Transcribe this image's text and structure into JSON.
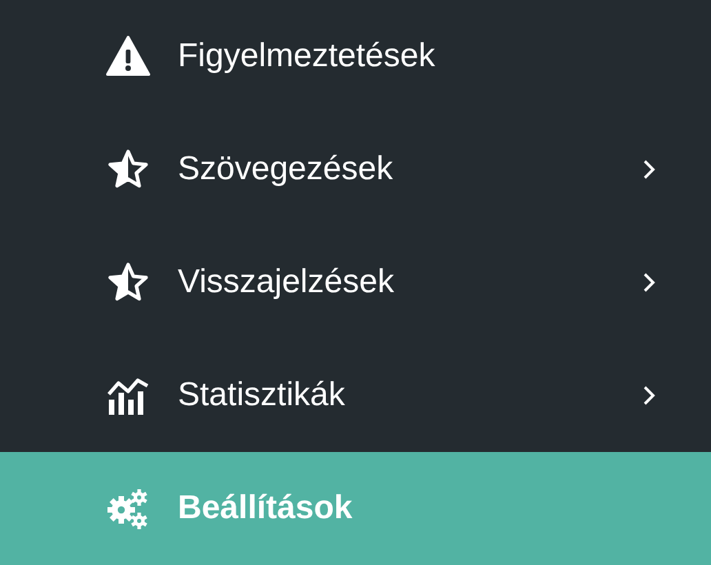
{
  "menu": {
    "items": [
      {
        "label": "Figyelmeztetések",
        "kind": "warning",
        "has_submenu": false,
        "selected": false
      },
      {
        "label": "Szövegezések",
        "kind": "rating",
        "has_submenu": true,
        "selected": false
      },
      {
        "label": "Visszajelzések",
        "kind": "rating",
        "has_submenu": true,
        "selected": false
      },
      {
        "label": "Statisztikák",
        "kind": "statistics",
        "has_submenu": true,
        "selected": false
      },
      {
        "label": "Beállítások",
        "kind": "settings",
        "has_submenu": false,
        "selected": true
      }
    ]
  }
}
